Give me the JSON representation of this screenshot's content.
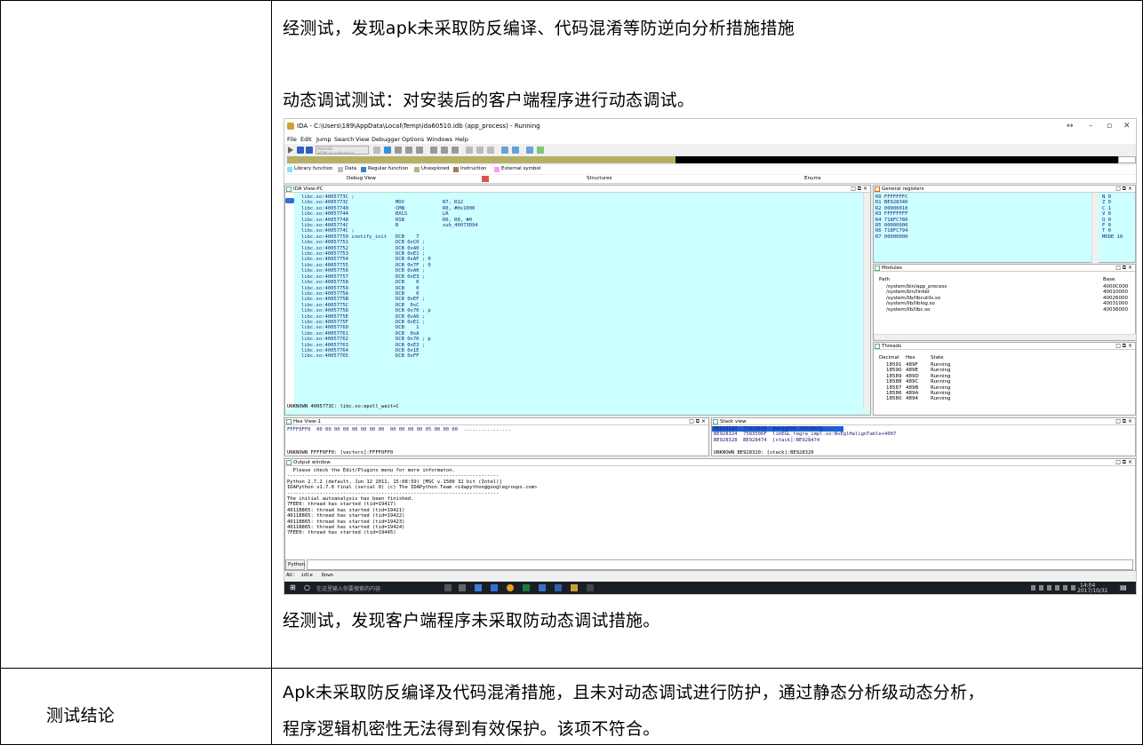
{
  "row1": {
    "line1": "经测试，发现apk未采取防反编译、代码混淆等防逆向分析措施措施",
    "line2": "动态调试测试：对安装后的客户端程序进行动态调试。",
    "line3": "经测试，发现客户端程序未采取防动态调试措施。"
  },
  "row2": {
    "label": "测试结论",
    "text_line1": "Apk未采取防反编译及代码混淆措施，且未对动态调试进行防护，通过静态分析级动态分析，",
    "text_line2": "程序逻辑机密性无法得到有效保护。该项不符合。"
  },
  "screenshot": {
    "title": "IDA - C:\\Users\\189\\AppData\\Local\\Temp\\ida60510.idb (app_process) - Running",
    "menu": [
      "File",
      "Edit",
      "Jump",
      "Search",
      "View",
      "Debugger",
      "Options",
      "Windows",
      "Help"
    ],
    "debugger_select": "Remote ARMLinux/Android debugger",
    "legend": [
      "Library function",
      "Data",
      "Regular function",
      "Unexplored",
      "Instruction",
      "External symbol"
    ],
    "legend_colors": [
      "#7fe3ff",
      "#bdbdbd",
      "#3b7dd8",
      "#b7b37a",
      "#a67c52",
      "#ff99ff"
    ],
    "tabs": [
      "Debug View",
      "Structures",
      "Enums"
    ],
    "ida_view_title": "IDA View-PC",
    "code_lines": [
      "libc.so:4005773C ;",
      "libc.so:4005773C                MOV             R7, R12",
      "libc.so:40057740                CMN             R0, #0x1000",
      "libc.so:40057744                BXLS            LR",
      "libc.so:40057748                RSB             R0, R0, #0",
      "libc.so:4005774C                B               sub_40073D94",
      "libc.so:4005774C ;",
      "libc.so:40057750 inotify_init   DCB    7",
      "libc.so:40057751                DCB 0xC0 ;",
      "libc.so:40057752                DCB 0xA0 ;",
      "libc.so:40057753                DCB 0xE1 ;",
      "libc.so:40057754                DCB 0xAF ; 0",
      "libc.so:40057755                DCB 0x7F ; 0",
      "libc.so:40057756                DCB 0xA0 ;",
      "libc.so:40057757                DCB 0xE3 ;",
      "libc.so:40057758                DCB    0",
      "libc.so:40057759                DCB    0",
      "libc.so:4005775A                DCB    0",
      "libc.so:4005775B                DCB 0xEF ;",
      "libc.so:4005775C                DCB  0xC",
      "libc.so:4005775D                DCB 0x70 ; p",
      "libc.so:4005775E                DCB 0xA0 ;",
      "libc.so:4005775F                DCB 0xE1 ;",
      "libc.so:40057760                DCB    1",
      "libc.so:40057761                DCB  0xA",
      "libc.so:40057762                DCB 0x70 ; p",
      "libc.so:40057763                DCB 0xE3 ;",
      "libc.so:40057764                DCB 0x1E",
      "libc.so:40057765                DCB 0xFF"
    ],
    "code_status": "UNKNOWN 4005773C: libc.so:epoll_wait+C",
    "registers_title": "General registers",
    "registers": [
      "R0 FFFFFFFC",
      "R1 BE928340",
      "R2 00000010",
      "R3 FFFFFFFF",
      "R4 718FC780",
      "R5 00000000",
      "R6 718FC794",
      "R7 00000000"
    ],
    "flags": [
      "N 0",
      "Z 0",
      "C 1",
      "V 0",
      "Q 0",
      "F 0",
      "T 0",
      "MODE 10"
    ],
    "modules_title": "Modules",
    "modules_head": [
      "Path",
      "Base"
    ],
    "modules": [
      [
        "/system/bin/app_process",
        "4000C000"
      ],
      [
        "/system/bin/linker",
        "40010000"
      ],
      [
        "/system/lib/libcutils.so",
        "40026000"
      ],
      [
        "/system/lib/liblog.so",
        "40031000"
      ],
      [
        "/system/lib/libc.so",
        "40036000"
      ]
    ],
    "threads_title": "Threads",
    "threads_head": [
      "Decimal",
      "Hex",
      "State"
    ],
    "threads": [
      [
        "18591",
        "489F",
        "Running"
      ],
      [
        "18590",
        "489E",
        "Running"
      ],
      [
        "18589",
        "489D",
        "Running"
      ],
      [
        "18588",
        "489C",
        "Running"
      ],
      [
        "18587",
        "489B",
        "Running"
      ],
      [
        "18586",
        "489A",
        "Running"
      ],
      [
        "18580",
        "4894",
        "Running"
      ]
    ],
    "hex_title": "Hex View-1",
    "hex_line": "FFFF0FF0  00 00 00 00 00 00 00 00  00 00 00 00 05 00 00 00  ................",
    "hex_status": "UNKNOWN FFFF0FF0: [vectors]:FFFF0FF0",
    "stack_title": "Stack view",
    "stack_lines": [
      "BE928320  75828550  debug099:75828550",
      "BE928324  7583506F  libEGL_tegra_impl.so:NvEglHalignTable+4007",
      "BE928328  BE928474  [stack]:BE928474"
    ],
    "stack_status": "UNKNOWN BE928320: [stack]:BE928320",
    "output_title": "Output window",
    "output_lines": [
      "  Please check the Edit/Plugins menu for more informaton.",
      "------------------------------------------------------------------------",
      "Python 2.7.2 (default, Jun 12 2011, 15:08:59) [MSC v.1500 32 bit (Intel)]",
      "IDAPython v1.7.0 final (serial 0) (c) The IDAPython Team <idapython@googlegroups.com>",
      "------------------------------------------------------------------------",
      "The initial autoanalysis has been finished.",
      "7FEE0: thread has started (tid=19417)",
      "4011B865: thread has started (tid=19421)",
      "4011B865: thread has started (tid=19422)",
      "4011B865: thread has started (tid=19423)",
      "4011B865: thread has started (tid=19424)",
      "7FEE0: thread has started (tid=19445)"
    ],
    "python_label": "Python",
    "status_line": "AU:  idle   Down",
    "search_placeholder": "在这里输入你要搜索的内容",
    "clock_time": "14:04",
    "clock_date": "2017/10/31"
  }
}
